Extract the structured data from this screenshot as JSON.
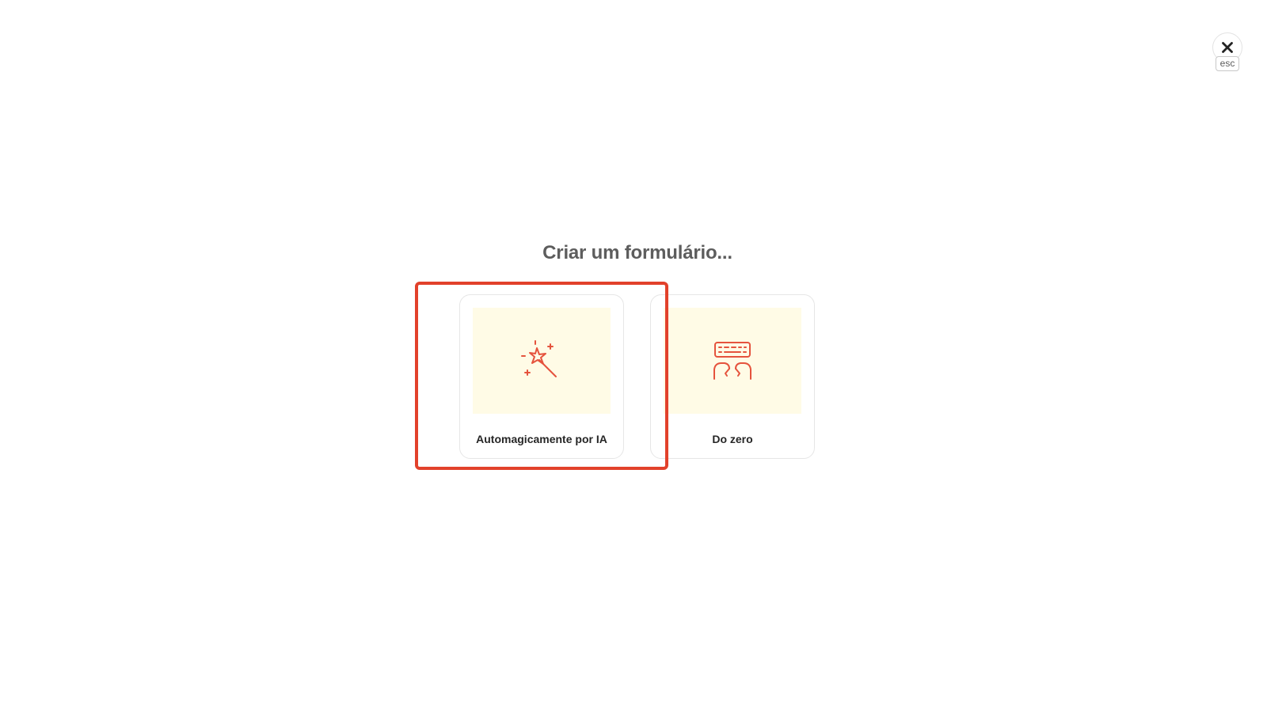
{
  "dialog": {
    "title": "Criar um formulário..."
  },
  "close": {
    "icon": "close-icon",
    "shortcut": "esc"
  },
  "options": [
    {
      "label": "Automagicamente por IA",
      "icon": "magic-wand-icon"
    },
    {
      "label": "Do zero",
      "icon": "typing-keyboard-icon"
    }
  ],
  "colors": {
    "accent": "#e2412b",
    "icon": "#e5533d",
    "card_art_background": "#fffbe6",
    "title": "#5d5d5d"
  }
}
